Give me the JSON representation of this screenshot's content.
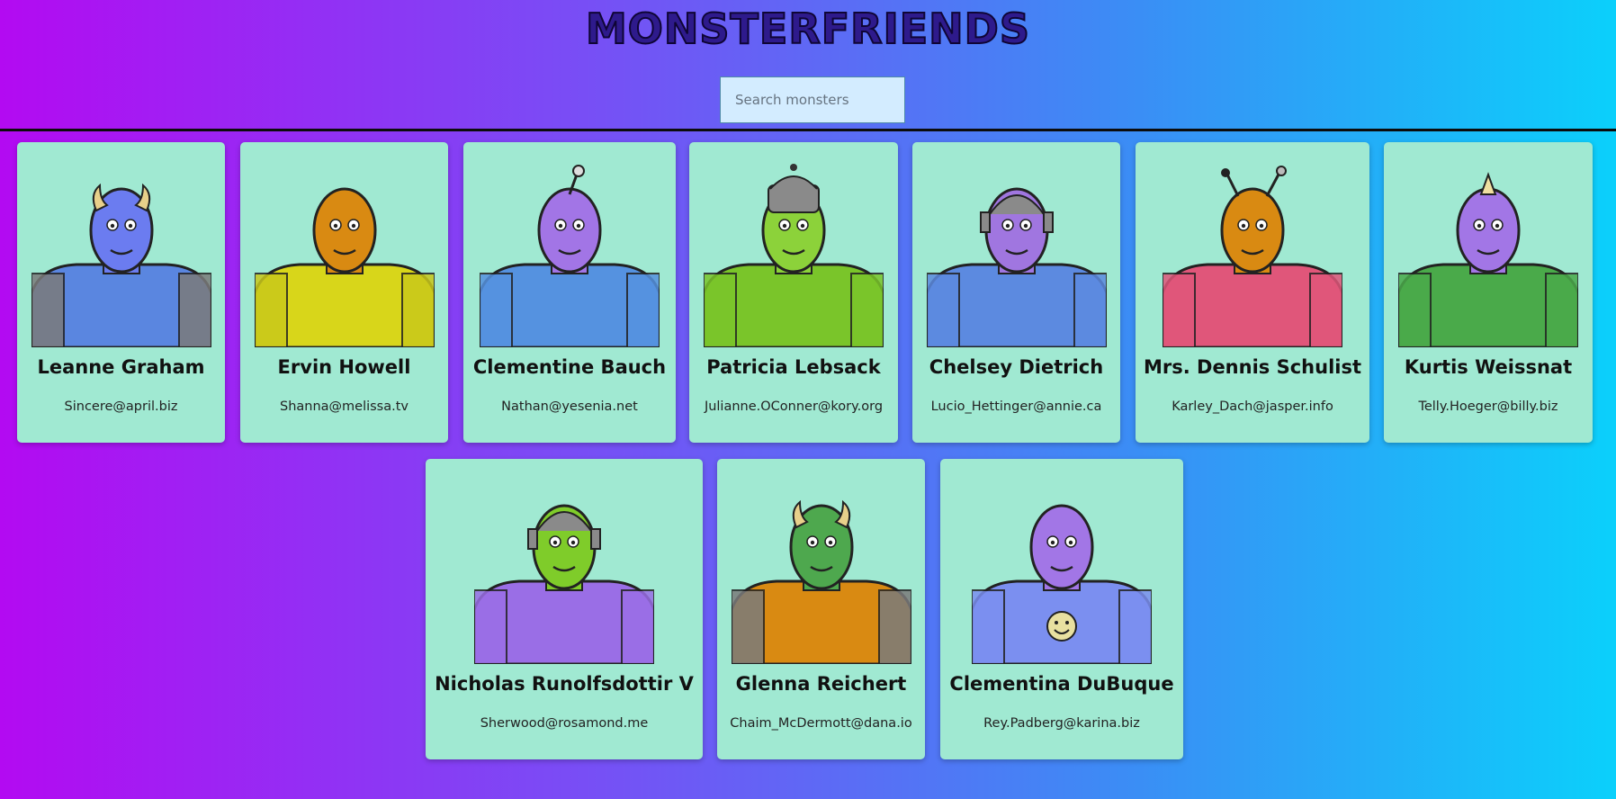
{
  "app": {
    "title": "MONSTERFRIENDS"
  },
  "search": {
    "placeholder": "Search monsters",
    "value": ""
  },
  "monsters": [
    {
      "name": "Leanne Graham",
      "email": "Sincere@april.biz",
      "skin": "#6b7cf0",
      "body": "#5a86e0",
      "shoulder": "#7b7b7b",
      "feature": "horns"
    },
    {
      "name": "Ervin Howell",
      "email": "Shanna@melissa.tv",
      "skin": "#d98a12",
      "body": "#d8d61a",
      "shoulder": "#c9c81a",
      "feature": "bald"
    },
    {
      "name": "Clementine Bauch",
      "email": "Nathan@yesenia.net",
      "skin": "#a275e6",
      "body": "#5592e0",
      "shoulder": "#5592e0",
      "feature": "antenna"
    },
    {
      "name": "Patricia Lebsack",
      "email": "Julianne.OConner@kory.org",
      "skin": "#8cd23a",
      "body": "#7ac52a",
      "shoulder": "#7ac52a",
      "feature": "helmet"
    },
    {
      "name": "Chelsey Dietrich",
      "email": "Lucio_Hettinger@annie.ca",
      "skin": "#a076e0",
      "body": "#5c8ae0",
      "shoulder": "#5c8ae0",
      "feature": "robot"
    },
    {
      "name": "Mrs. Dennis Schulist",
      "email": "Karley_Dach@jasper.info",
      "skin": "#d98a12",
      "body": "#e0567a",
      "shoulder": "#e0567a",
      "feature": "antennae"
    },
    {
      "name": "Kurtis Weissnat",
      "email": "Telly.Hoeger@billy.biz",
      "skin": "#a276e6",
      "body": "#4aaa4a",
      "shoulder": "#4aaa4a",
      "feature": "horn"
    },
    {
      "name": "Nicholas Runolfsdottir V",
      "email": "Sherwood@rosamond.me",
      "skin": "#7fcc2a",
      "body": "#9a6ee6",
      "shoulder": "#9a6ee6",
      "feature": "robot"
    },
    {
      "name": "Glenna Reichert",
      "email": "Chaim_McDermott@dana.io",
      "skin": "#4ea84e",
      "body": "#d98a12",
      "shoulder": "#7b7b7b",
      "feature": "horns"
    },
    {
      "name": "Clementina DuBuque",
      "email": "Rey.Padberg@karina.biz",
      "skin": "#a276e6",
      "body": "#7b8ff0",
      "shoulder": "#7b8ff0",
      "feature": "smiley"
    }
  ]
}
